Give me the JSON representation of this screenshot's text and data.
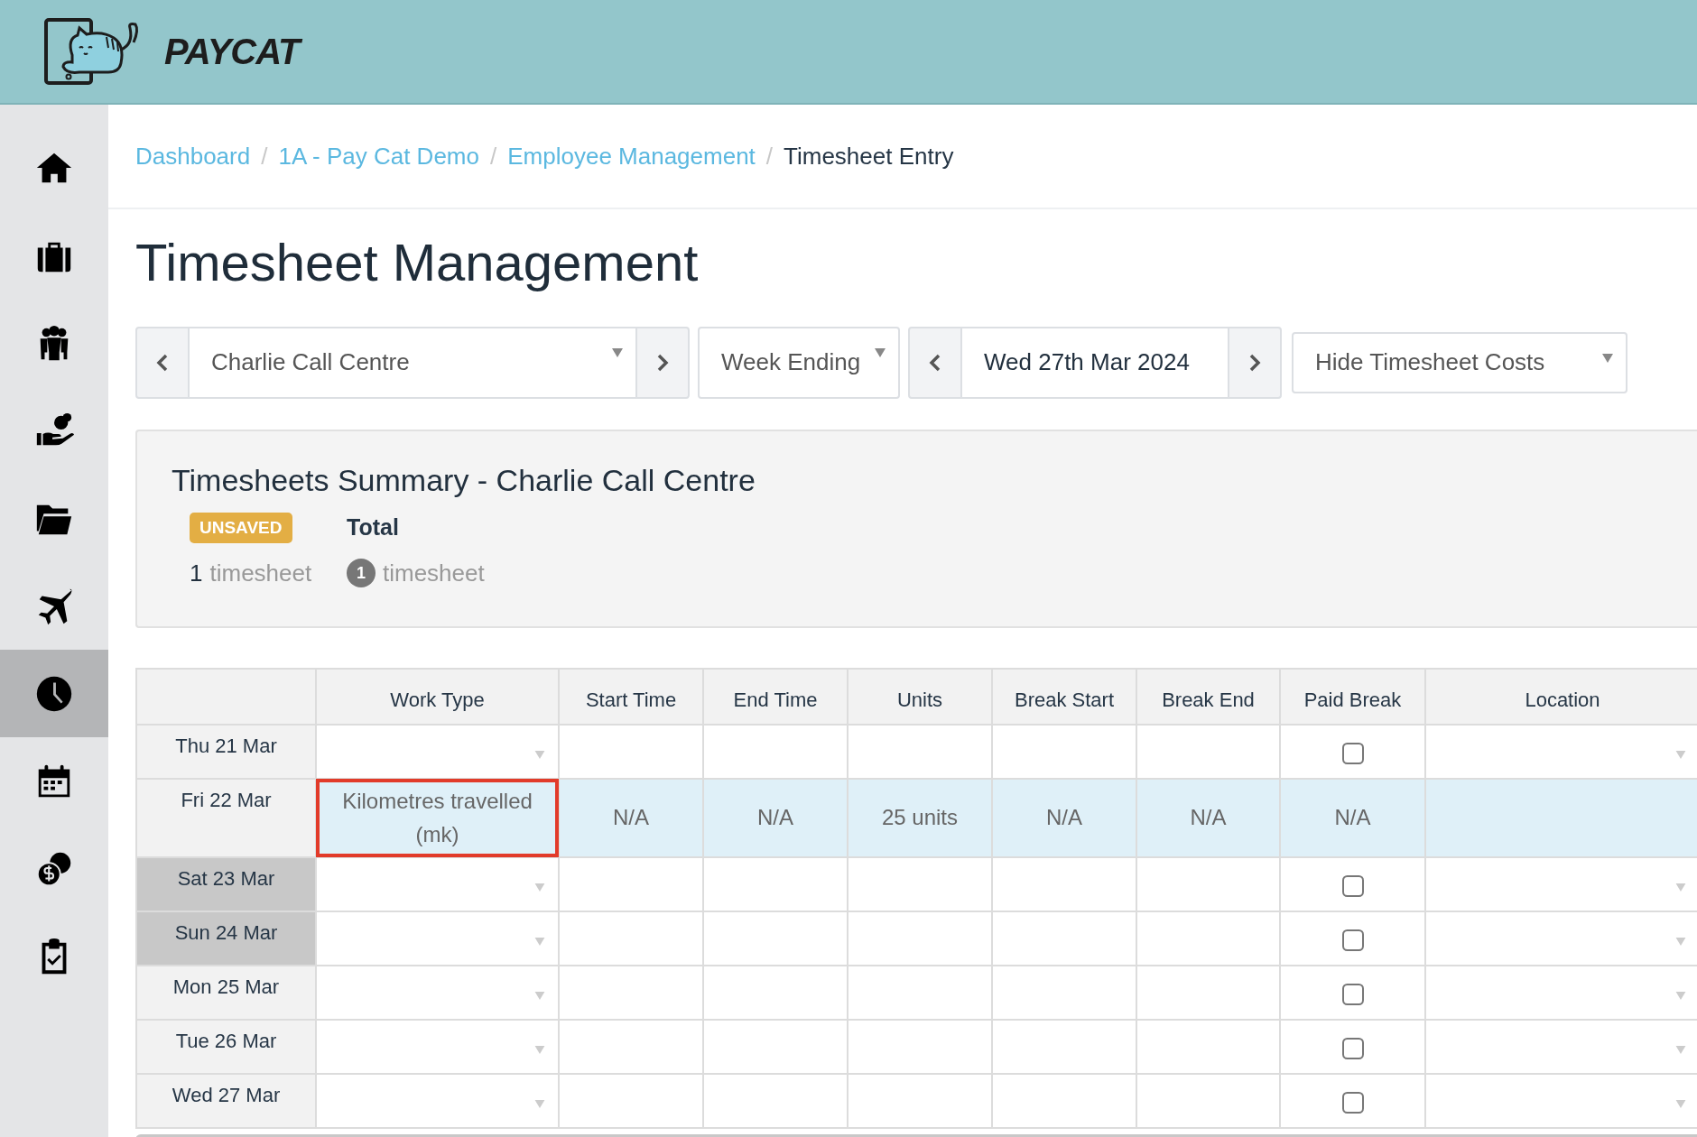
{
  "header": {
    "logo_text": "PAYCAT"
  },
  "sidebar": {
    "items": [
      {
        "kind": "home",
        "selected": false
      },
      {
        "kind": "briefcase",
        "selected": false
      },
      {
        "kind": "people",
        "selected": false
      },
      {
        "kind": "pay",
        "selected": false
      },
      {
        "kind": "folder",
        "selected": false
      },
      {
        "kind": "plane",
        "selected": false
      },
      {
        "kind": "clock",
        "selected": true
      },
      {
        "kind": "calendar",
        "selected": false
      },
      {
        "kind": "coins",
        "selected": false
      },
      {
        "kind": "clipboard",
        "selected": false
      }
    ]
  },
  "breadcrumb_separator": "/",
  "breadcrumb": [
    {
      "label": "Dashboard",
      "link": true
    },
    {
      "label": "1A - Pay Cat Demo",
      "link": true
    },
    {
      "label": "Employee Management",
      "link": true
    },
    {
      "label": "Timesheet Entry",
      "link": false
    }
  ],
  "title": "Timesheet Management",
  "filters": {
    "location": "Charlie Call Centre",
    "period_type": "Week Ending",
    "date": "Wed 27th Mar 2024",
    "costs": "Hide Timesheet Costs"
  },
  "summary": {
    "title": "Timesheets Summary - Charlie Call Centre",
    "unsaved": {
      "badge": "UNSAVED",
      "count": "1",
      "unit": "timesheet"
    },
    "total": {
      "label": "Total",
      "count": "1",
      "unit": "timesheet"
    }
  },
  "table": {
    "columns": [
      "Work Type",
      "Start Time",
      "End Time",
      "Units",
      "Break Start",
      "Break End",
      "Paid Break",
      "Location"
    ],
    "rows": [
      {
        "date": "Thu 21 Mar",
        "weekend": false,
        "selected": false,
        "kind": "empty",
        "checked": false
      },
      {
        "date": "Fri 22 Mar",
        "weekend": false,
        "selected": true,
        "kind": "entry",
        "work_type": "Kilometres travelled (mk)",
        "start_time": "N/A",
        "end_time": "N/A",
        "units": "25 units",
        "break_start": "N/A",
        "break_end": "N/A",
        "paid_break": "N/A"
      },
      {
        "date": "Sat 23 Mar",
        "weekend": true,
        "selected": false,
        "kind": "empty",
        "checked": false
      },
      {
        "date": "Sun 24 Mar",
        "weekend": true,
        "selected": false,
        "kind": "empty",
        "checked": false
      },
      {
        "date": "Mon 25 Mar",
        "weekend": false,
        "selected": false,
        "kind": "empty",
        "checked": false
      },
      {
        "date": "Tue 26 Mar",
        "weekend": false,
        "selected": false,
        "kind": "empty",
        "checked": false
      },
      {
        "date": "Wed 27 Mar",
        "weekend": false,
        "selected": false,
        "kind": "empty",
        "checked": false
      }
    ]
  }
}
